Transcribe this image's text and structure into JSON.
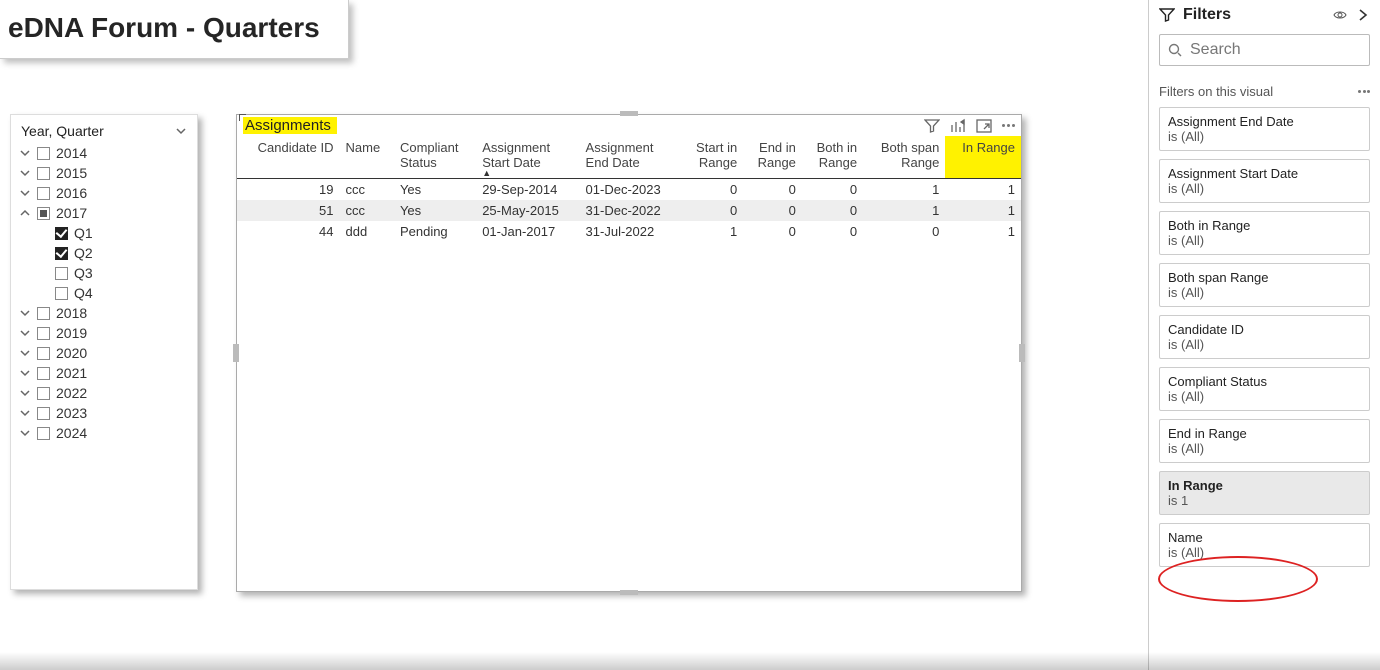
{
  "page_title": "eDNA Forum - Quarters",
  "slicer": {
    "header": "Year, Quarter",
    "years": [
      {
        "label": "2014",
        "expanded": false,
        "state": "off"
      },
      {
        "label": "2015",
        "expanded": false,
        "state": "off"
      },
      {
        "label": "2016",
        "expanded": false,
        "state": "off"
      },
      {
        "label": "2017",
        "expanded": true,
        "state": "mixed",
        "children": [
          {
            "label": "Q1",
            "state": "on"
          },
          {
            "label": "Q2",
            "state": "on"
          },
          {
            "label": "Q3",
            "state": "off"
          },
          {
            "label": "Q4",
            "state": "off"
          }
        ]
      },
      {
        "label": "2018",
        "expanded": false,
        "state": "off"
      },
      {
        "label": "2019",
        "expanded": false,
        "state": "off"
      },
      {
        "label": "2020",
        "expanded": false,
        "state": "off"
      },
      {
        "label": "2021",
        "expanded": false,
        "state": "off"
      },
      {
        "label": "2022",
        "expanded": false,
        "state": "off"
      },
      {
        "label": "2023",
        "expanded": false,
        "state": "off"
      },
      {
        "label": "2024",
        "expanded": false,
        "state": "off"
      }
    ]
  },
  "table": {
    "title": "Assignments",
    "columns": [
      {
        "key": "cand",
        "label": "Candidate ID",
        "align": "num"
      },
      {
        "key": "name",
        "label": "Name"
      },
      {
        "key": "status",
        "label": "Compliant Status"
      },
      {
        "key": "asd",
        "label": "Assignment Start Date",
        "sorted": true
      },
      {
        "key": "aed",
        "label": "Assignment End Date"
      },
      {
        "key": "sir",
        "label": "Start in Range",
        "align": "num"
      },
      {
        "key": "eir",
        "label": "End in Range",
        "align": "num"
      },
      {
        "key": "bir",
        "label": "Both in Range",
        "align": "num"
      },
      {
        "key": "bsr",
        "label": "Both span Range",
        "align": "num"
      },
      {
        "key": "inr",
        "label": "In Range",
        "align": "num",
        "highlight": true
      }
    ],
    "rows": [
      {
        "cand": "19",
        "name": "ccc",
        "status": "Yes",
        "asd": "29-Sep-2014",
        "aed": "01-Dec-2023",
        "sir": "0",
        "eir": "0",
        "bir": "0",
        "bsr": "1",
        "inr": "1"
      },
      {
        "cand": "51",
        "name": "ccc",
        "status": "Yes",
        "asd": "25-May-2015",
        "aed": "31-Dec-2022",
        "sir": "0",
        "eir": "0",
        "bir": "0",
        "bsr": "1",
        "inr": "1",
        "alt": true
      },
      {
        "cand": "44",
        "name": "ddd",
        "status": "Pending",
        "asd": "01-Jan-2017",
        "aed": "31-Jul-2022",
        "sir": "1",
        "eir": "0",
        "bir": "0",
        "bsr": "0",
        "inr": "1"
      }
    ]
  },
  "filters": {
    "title": "Filters",
    "search_placeholder": "Search",
    "section": "Filters on this visual",
    "cards": [
      {
        "name": "Assignment End Date",
        "state": "is (All)"
      },
      {
        "name": "Assignment Start Date",
        "state": "is (All)"
      },
      {
        "name": "Both in Range",
        "state": "is (All)"
      },
      {
        "name": "Both span Range",
        "state": "is (All)"
      },
      {
        "name": "Candidate ID",
        "state": "is (All)"
      },
      {
        "name": "Compliant Status",
        "state": "is (All)"
      },
      {
        "name": "End in Range",
        "state": "is (All)"
      },
      {
        "name": "In Range",
        "state": "is 1",
        "selected": true
      },
      {
        "name": "Name",
        "state": "is (All)"
      }
    ]
  }
}
